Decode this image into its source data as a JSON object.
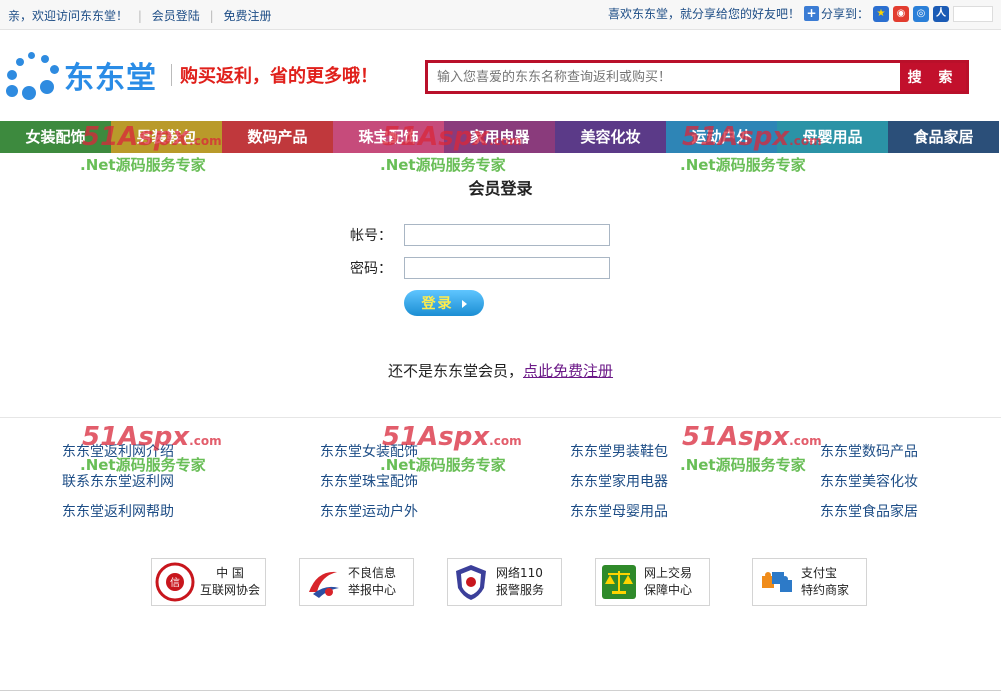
{
  "topbar": {
    "greeting": "亲，欢迎访问东东堂！",
    "login_link": "会员登陆",
    "register_link": "免费注册",
    "share_prompt": "喜欢东东堂，就分享给您的好友吧！",
    "share_label": "分享到："
  },
  "header": {
    "logo_text": "东东堂",
    "slogan": "购买返利，省的更多哦！",
    "search_placeholder": "输入您喜爱的东东名称查询返利或购买！",
    "search_button": "搜 索"
  },
  "nav": [
    {
      "label": "女装配饰",
      "color": "#3d8a3e"
    },
    {
      "label": "男装鞋包",
      "color": "#b99a2a"
    },
    {
      "label": "数码产品",
      "color": "#c0383c"
    },
    {
      "label": "珠宝配饰",
      "color": "#c64b7b"
    },
    {
      "label": "家用电器",
      "color": "#8a3b7c"
    },
    {
      "label": "美容化妆",
      "color": "#5b3a88"
    },
    {
      "label": "运动户外",
      "color": "#2e85b6"
    },
    {
      "label": "母婴用品",
      "color": "#2b93a6"
    },
    {
      "label": "食品家居",
      "color": "#2b4f79"
    }
  ],
  "watermark": {
    "brand": "51Aspx",
    "domain": ".com",
    "subtitle": ".Net源码服务专家"
  },
  "login": {
    "title": "会员登录",
    "account_label": "帐号：",
    "password_label": "密码：",
    "submit": "登录",
    "not_member_text": "还不是东东堂会员，",
    "register_link": "点此免费注册"
  },
  "footer_links": [
    "东东堂返利网介绍",
    "东东堂女装配饰",
    "东东堂男装鞋包",
    "东东堂数码产品",
    "联系东东堂返利网",
    "东东堂珠宝配饰",
    "东东堂家用电器",
    "东东堂美容化妆",
    "东东堂返利网帮助",
    "东东堂运动户外",
    "东东堂母婴用品",
    "东东堂食品家居"
  ],
  "badges": [
    {
      "line1": "中  国",
      "line2": "互联网协会",
      "icon": "trust-seal-icon"
    },
    {
      "line1": "不良信息",
      "line2": "举报中心",
      "icon": "report-center-icon"
    },
    {
      "line1": "网络110",
      "line2": "报警服务",
      "icon": "police-shield-icon"
    },
    {
      "line1": "网上交易",
      "line2": "保障中心",
      "icon": "scale-balance-icon"
    },
    {
      "line1": "支付宝",
      "line2": "特约商家",
      "icon": "alipay-puzzle-icon"
    }
  ]
}
